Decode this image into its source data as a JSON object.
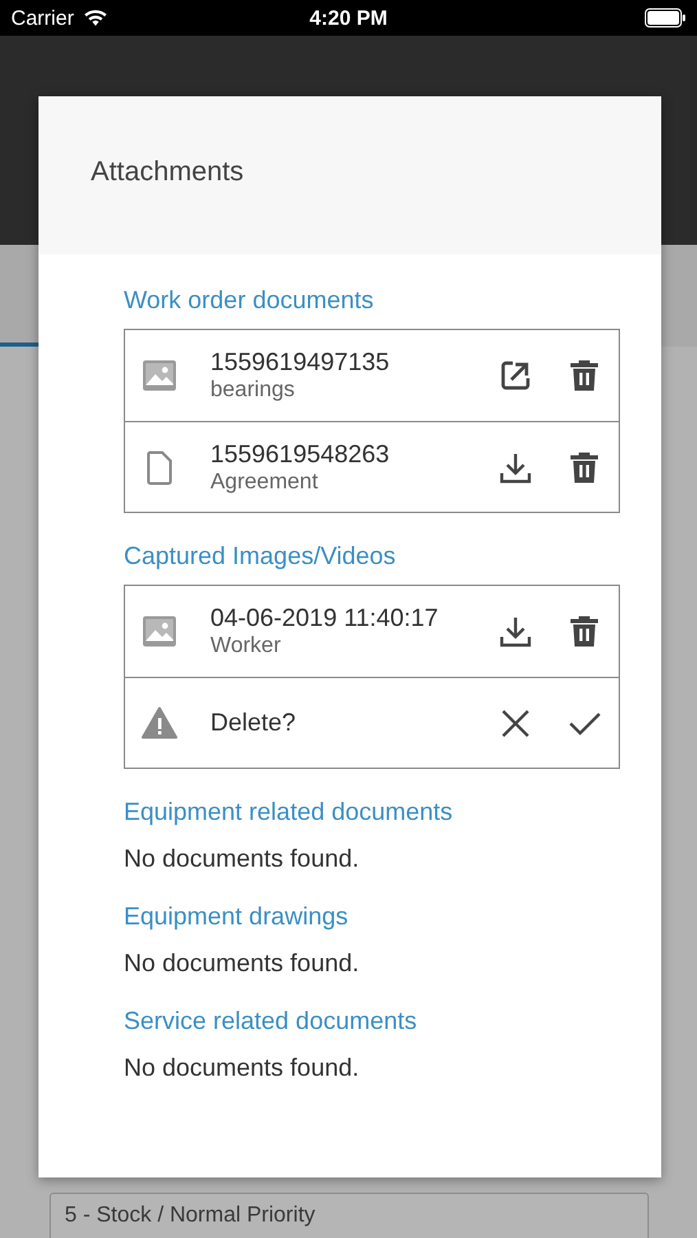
{
  "status_bar": {
    "carrier": "Carrier",
    "time": "4:20 PM"
  },
  "form": {
    "priority_value": "5 - Stock / Normal Priority"
  },
  "dialog": {
    "title": "Attachments",
    "sections": [
      {
        "heading": "Work order documents",
        "items": [
          {
            "kind": "image",
            "name": "1559619497135",
            "caption": "bearings",
            "downloaded": true
          },
          {
            "kind": "document",
            "name": "1559619548263",
            "caption": "Agreement",
            "downloaded": false
          }
        ]
      },
      {
        "heading": "Captured Images/Videos",
        "items": [
          {
            "kind": "image",
            "name": "04-06-2019 11:40:17",
            "caption": "Worker",
            "downloaded": false
          },
          {
            "kind": "confirm",
            "name": "Delete?"
          }
        ]
      },
      {
        "heading": "Equipment related documents",
        "empty_text": "No documents found."
      },
      {
        "heading": "Equipment drawings",
        "empty_text": "No documents found."
      },
      {
        "heading": "Service related documents",
        "empty_text": "No documents found."
      }
    ]
  }
}
